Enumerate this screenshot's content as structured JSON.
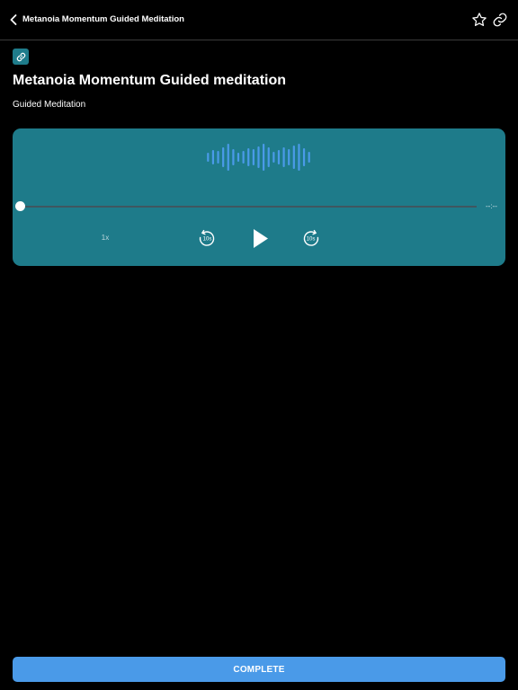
{
  "header": {
    "title": "Metanoia Momentum Guided Meditation",
    "back_icon": "chevron-left-icon",
    "favorite_icon": "star-icon",
    "share_icon": "link-icon"
  },
  "content": {
    "type_icon": "link-icon",
    "title": "Metanoia Momentum Guided meditation",
    "subtitle": "Guided Meditation"
  },
  "player": {
    "time": "--:--",
    "speed": "1x",
    "rewind_label": "10s",
    "forward_label": "10s",
    "progress": 0,
    "waveform_icon": "audio-waveform-icon",
    "play_icon": "play-icon",
    "rewind_icon": "rewind-10-icon",
    "forward_icon": "forward-10-icon"
  },
  "footer": {
    "complete_label": "COMPLETE"
  },
  "colors": {
    "background": "#000000",
    "player_card": "#1e7b8a",
    "badge": "#1f7c8b",
    "waveform": "#4a9ae8",
    "complete_button": "#4a9ae8"
  }
}
